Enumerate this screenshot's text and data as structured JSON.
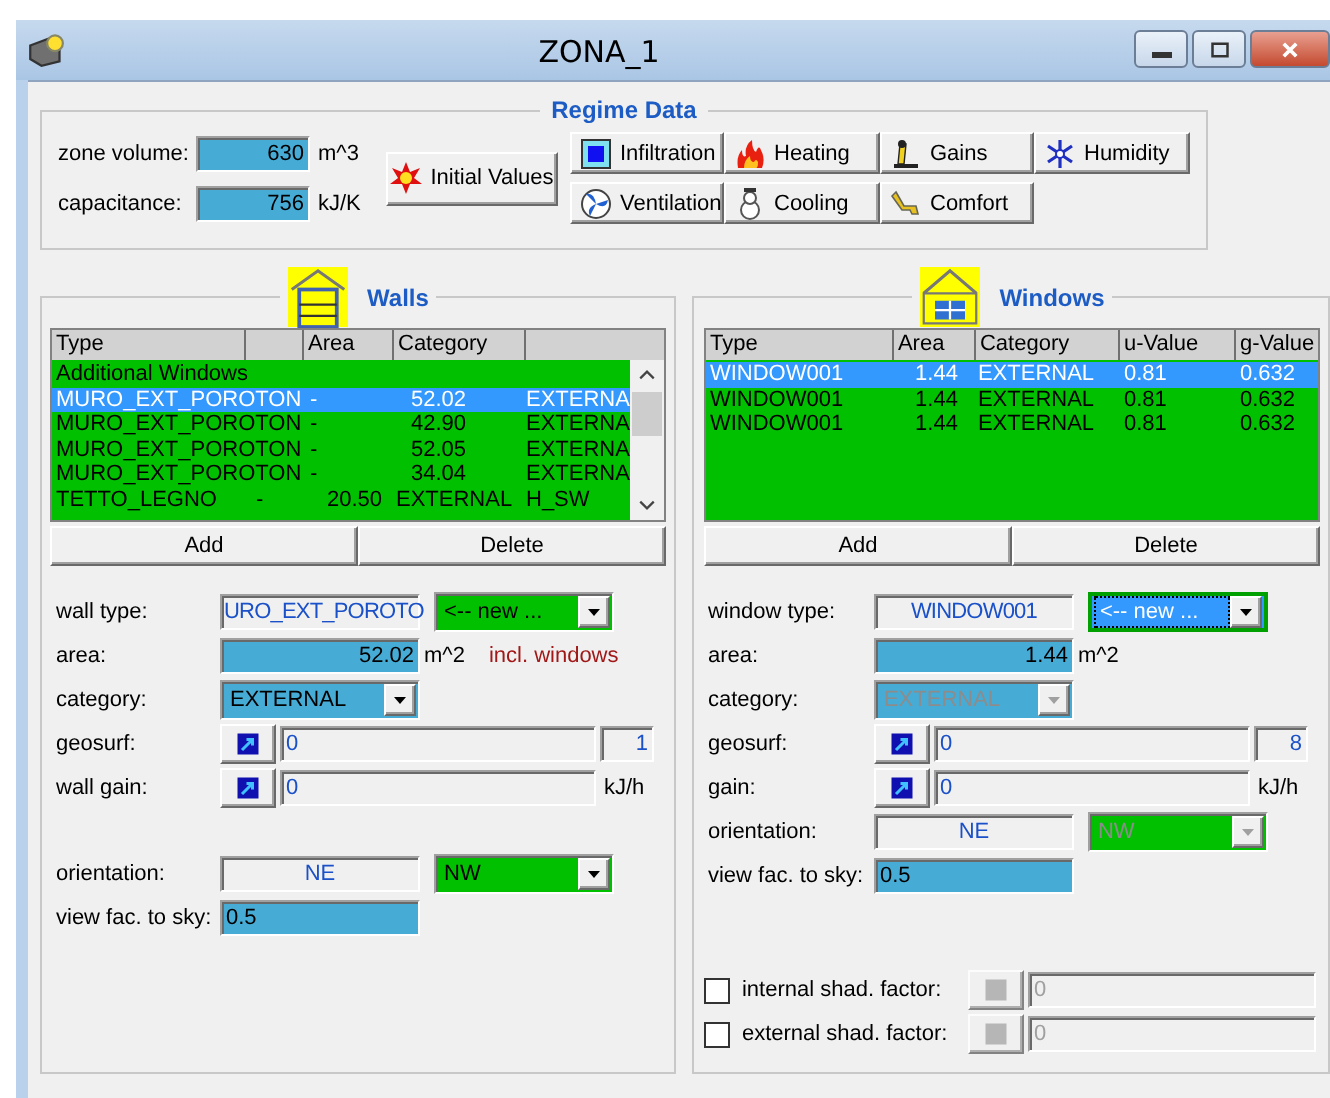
{
  "window": {
    "title": "ZONA_1"
  },
  "regime": {
    "title": "Regime Data",
    "fields": [
      {
        "label": "zone volume:",
        "value": "630",
        "unit": "m^3"
      },
      {
        "label": "capacitance:",
        "value": "756",
        "unit": "kJ/K"
      }
    ],
    "initial_button": "Initial Values",
    "buttons": [
      {
        "label": "Infiltration",
        "kind": "infiltration"
      },
      {
        "label": "Heating",
        "kind": "heating"
      },
      {
        "label": "Gains",
        "kind": "gains"
      },
      {
        "label": "Humidity",
        "kind": "humidity"
      },
      {
        "label": "Ventilation",
        "kind": "ventilation"
      },
      {
        "label": "Cooling",
        "kind": "cooling"
      },
      {
        "label": "Comfort",
        "kind": "comfort"
      }
    ]
  },
  "walls": {
    "title": "Walls",
    "columns": [
      "Type",
      "",
      "Area",
      "Category",
      ""
    ],
    "rows": [
      {
        "kind": "group",
        "cells": [
          "Additional Windows"
        ],
        "selected": false
      },
      {
        "kind": "long",
        "cells": [
          "MURO_EXT_POROTON",
          "",
          "-",
          "52.02",
          "EXTERNA"
        ],
        "selected": true
      },
      {
        "kind": "long",
        "cells": [
          "MURO_EXT_POROTON",
          "",
          "-",
          "42.90",
          "EXTERNA"
        ],
        "selected": false
      },
      {
        "kind": "long",
        "cells": [
          "MURO_EXT_POROTON",
          "",
          "-",
          "52.05",
          "EXTERNA"
        ],
        "selected": false
      },
      {
        "kind": "long",
        "cells": [
          "MURO_EXT_POROTON",
          "",
          "-",
          "34.04",
          "EXTERNA"
        ],
        "selected": false
      },
      {
        "kind": "short",
        "cells": [
          "TETTO_LEGNO",
          "-",
          "20.50",
          "EXTERNAL",
          "H_SW"
        ],
        "selected": false
      }
    ],
    "add_button": "Add",
    "delete_button": "Delete",
    "type": {
      "label": "wall type:",
      "value": "URO_EXT_POROTO",
      "dropdown": "<-- new ...",
      "focused": false
    },
    "area": {
      "label": "area:",
      "value": "52.02",
      "unit": "m^2",
      "note": "incl. windows"
    },
    "category": {
      "label": "category:",
      "value": "EXTERNAL",
      "disabled": false
    },
    "geosurf": {
      "label": "geosurf:",
      "value": "0",
      "count": "1"
    },
    "gain": {
      "label": "wall gain:",
      "value": "0",
      "unit": "kJ/h"
    },
    "orientation": {
      "label": "orientation:",
      "value": "NE",
      "dropdown": "NW",
      "disabled": false
    },
    "view": {
      "label": "view fac. to sky:",
      "value": "0.5"
    }
  },
  "windows": {
    "title": "Windows",
    "columns": [
      "Type",
      "Area",
      "Category",
      "u-Value",
      "g-Value"
    ],
    "rows": [
      {
        "kind": "window",
        "cells": [
          "WINDOW001",
          "1.44",
          "EXTERNAL",
          "0.81",
          "0.632"
        ],
        "selected": true
      },
      {
        "kind": "window",
        "cells": [
          "WINDOW001",
          "1.44",
          "EXTERNAL",
          "0.81",
          "0.632"
        ],
        "selected": false
      },
      {
        "kind": "window",
        "cells": [
          "WINDOW001",
          "1.44",
          "EXTERNAL",
          "0.81",
          "0.632"
        ],
        "selected": false
      }
    ],
    "add_button": "Add",
    "delete_button": "Delete",
    "type": {
      "label": "window type:",
      "value": "WINDOW001",
      "dropdown": "<-- new ...",
      "focused": true
    },
    "area": {
      "label": "area:",
      "value": "1.44",
      "unit": "m^2"
    },
    "category": {
      "label": "category:",
      "value": "EXTERNAL",
      "disabled": true
    },
    "geosurf": {
      "label": "geosurf:",
      "value": "0",
      "count": "8"
    },
    "gain": {
      "label": "gain:",
      "value": "0",
      "unit": "kJ/h"
    },
    "orientation": {
      "label": "orientation:",
      "value": "NE",
      "dropdown": "NW",
      "disabled": true
    },
    "view": {
      "label": "view fac. to sky:",
      "value": "0.5"
    },
    "shading": [
      {
        "label": "internal shad. factor:",
        "checked": false,
        "value": "0"
      },
      {
        "label": "external shad. factor:",
        "checked": false,
        "value": "0"
      }
    ]
  }
}
